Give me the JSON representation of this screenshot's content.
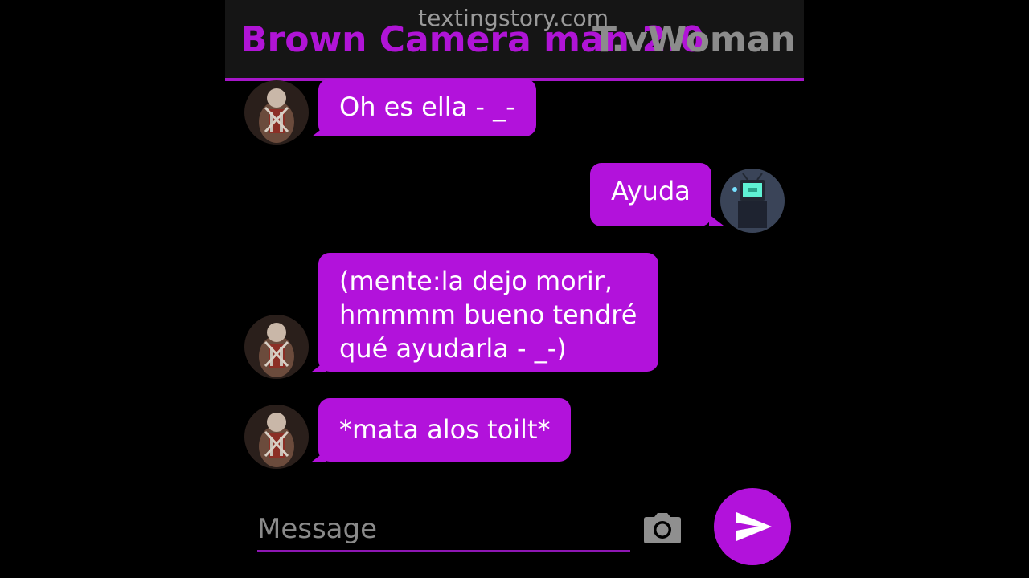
{
  "header": {
    "watermark": "textingstory.com",
    "contact_name": "Brown Camera man 2.0",
    "contact_name_overlap": "T.vWoman"
  },
  "messages": [
    {
      "side": "left",
      "text": "Oh es ella - _-"
    },
    {
      "side": "right",
      "text": "Ayuda"
    },
    {
      "side": "left",
      "lines": [
        "(mente:la dejo morir,",
        "hmmmm bueno tendré",
        "qué ayudarla - _-)"
      ]
    },
    {
      "side": "left",
      "text": "*mata alos toilt*"
    }
  ],
  "composer": {
    "placeholder": "Message"
  },
  "icons": {
    "camera": "camera-icon",
    "send": "send-icon"
  },
  "colors": {
    "accent": "#b212db",
    "header_bg": "#151515",
    "background": "#000000"
  }
}
